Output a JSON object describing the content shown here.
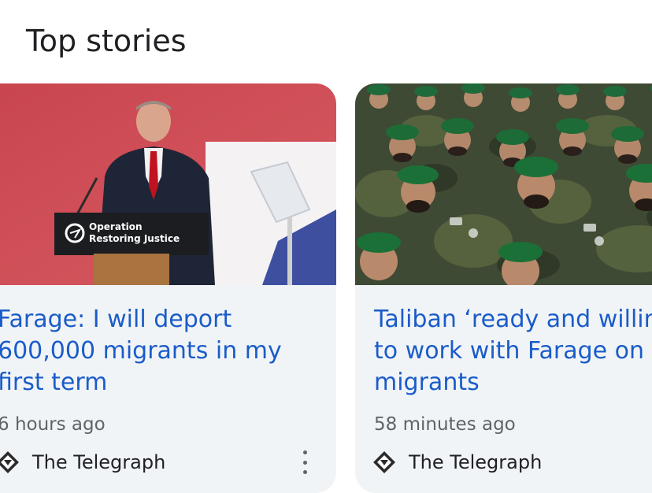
{
  "section": {
    "title": "Top stories"
  },
  "stories": [
    {
      "headline": "Farage: I will deport\n600,000 migrants in my\nfirst term",
      "time": "6 hours ago",
      "source": "The Telegraph",
      "image_sign": {
        "line1": "Operation",
        "line2": "Restoring Justice"
      }
    },
    {
      "headline": "Taliban ‘ready and willing\nto work with Farage on\nmigrants",
      "time": "58 minutes ago",
      "source": "The Telegraph"
    }
  ],
  "colors": {
    "headline": "#1a5cc8",
    "card_bg": "#f1f4f7",
    "meta": "#5f6368"
  },
  "icons": {
    "source_logo": "telegraph-logo-icon",
    "more": "more-vert-icon"
  }
}
